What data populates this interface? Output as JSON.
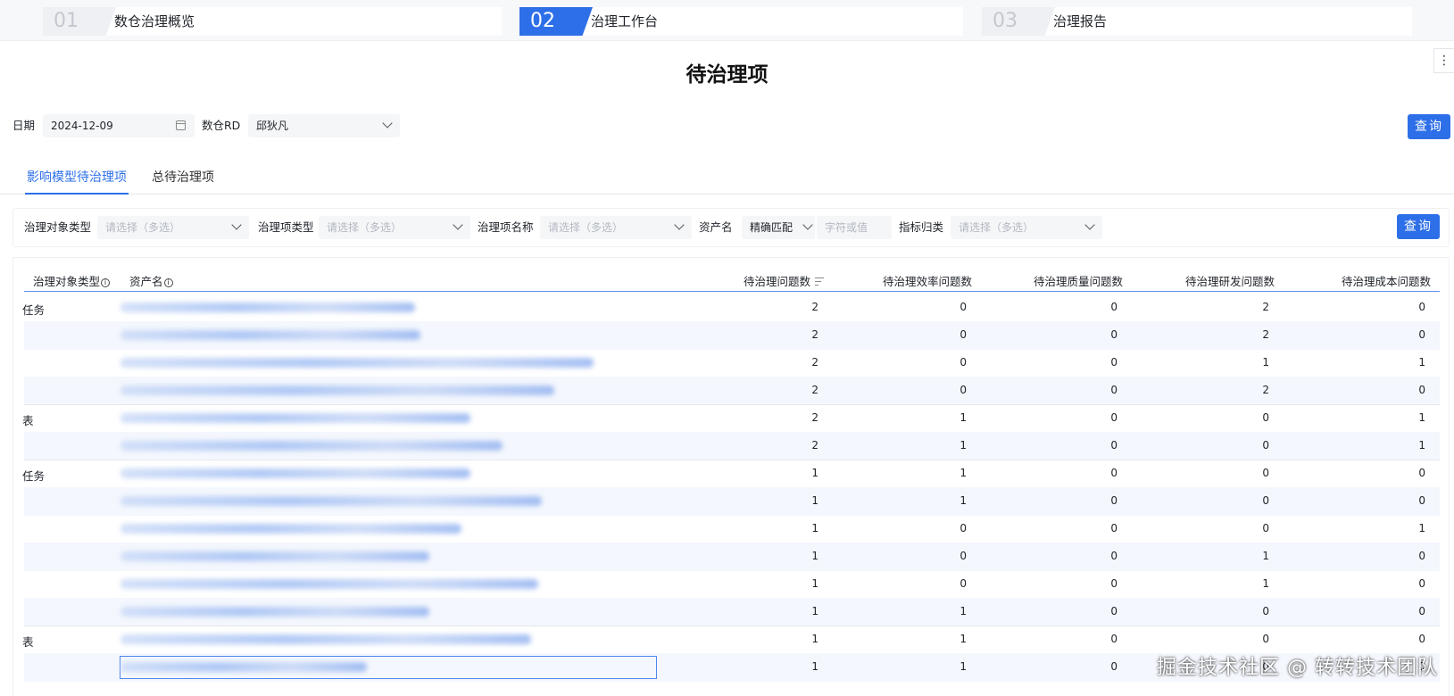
{
  "steps": [
    {
      "num": "01",
      "label": "数仓治理概览"
    },
    {
      "num": "02",
      "label": "治理工作台"
    },
    {
      "num": "03",
      "label": "治理报告"
    }
  ],
  "menu_glyph": "⋮",
  "page_title": "待治理项",
  "filters": {
    "date_label": "日期",
    "date_value": "2024-12-09",
    "rd_label": "数仓RD",
    "rd_value": "邱狄凡",
    "query_label": "查询"
  },
  "tabs": [
    "影响模型待治理项",
    "总待治理项"
  ],
  "subfilters": {
    "object_type_label": "治理对象类型",
    "item_type_label": "治理项类型",
    "item_name_label": "治理项名称",
    "asset_name_label": "资产名",
    "match_mode": "精确匹配",
    "keyword_placeholder": "字符或值",
    "indicator_label": "指标归类",
    "multi_placeholder": "请选择（多选）",
    "query_label": "查询"
  },
  "table": {
    "headers": {
      "object_type": "治理对象类型",
      "asset_name": "资产名",
      "pending": "待治理问题数",
      "efficiency": "待治理效率问题数",
      "quality": "待治理质量问题数",
      "rd": "待治理研发问题数",
      "cost": "待治理成本问题数"
    },
    "groups": [
      {
        "type": "任务",
        "rows": [
          {
            "pending": "2",
            "efficiency": "0",
            "quality": "0",
            "rd": "2",
            "cost": "0"
          },
          {
            "pending": "2",
            "efficiency": "0",
            "quality": "0",
            "rd": "2",
            "cost": "0"
          },
          {
            "pending": "2",
            "efficiency": "0",
            "quality": "0",
            "rd": "1",
            "cost": "1"
          },
          {
            "pending": "2",
            "efficiency": "0",
            "quality": "0",
            "rd": "2",
            "cost": "0"
          }
        ]
      },
      {
        "type": "表",
        "rows": [
          {
            "pending": "2",
            "efficiency": "1",
            "quality": "0",
            "rd": "0",
            "cost": "1"
          },
          {
            "pending": "2",
            "efficiency": "1",
            "quality": "0",
            "rd": "0",
            "cost": "1"
          }
        ]
      },
      {
        "type": "任务",
        "rows": [
          {
            "pending": "1",
            "efficiency": "1",
            "quality": "0",
            "rd": "0",
            "cost": "0"
          },
          {
            "pending": "1",
            "efficiency": "1",
            "quality": "0",
            "rd": "0",
            "cost": "0"
          },
          {
            "pending": "1",
            "efficiency": "0",
            "quality": "0",
            "rd": "0",
            "cost": "1"
          },
          {
            "pending": "1",
            "efficiency": "0",
            "quality": "0",
            "rd": "1",
            "cost": "0"
          },
          {
            "pending": "1",
            "efficiency": "0",
            "quality": "0",
            "rd": "1",
            "cost": "0"
          },
          {
            "pending": "1",
            "efficiency": "1",
            "quality": "0",
            "rd": "0",
            "cost": "0"
          }
        ]
      },
      {
        "type": "表",
        "rows": [
          {
            "pending": "1",
            "efficiency": "1",
            "quality": "0",
            "rd": "0",
            "cost": "0"
          },
          {
            "pending": "1",
            "efficiency": "1",
            "quality": "0",
            "rd": "0",
            "cost": "0"
          }
        ]
      }
    ]
  },
  "watermark": "掘金技术社区 @ 转转技术团队",
  "colors": {
    "accent": "#2d6fe8",
    "row_alt": "#f4f7fd",
    "header_rule": "#5b8ff0"
  }
}
